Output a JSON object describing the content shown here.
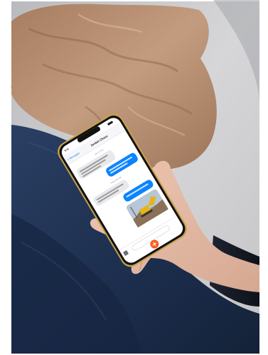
{
  "photo": {
    "description_colors": {
      "sofa": "#cfcfd1",
      "blanket": "#b68c6e",
      "jeans": "#1f3253",
      "skin": "#e2b9a3",
      "phone_frame": "#c9a14a"
    }
  },
  "phone_screen": {
    "status_time": "9:41",
    "back_label": "< Messages",
    "contact_name": "Jordan Chase",
    "timestamp_1": "Mar 14 9:41",
    "timestamp_2": "Today 9:41 AM",
    "messages": [
      {
        "side": "in",
        "text": ""
      },
      {
        "side": "out",
        "text": ""
      },
      {
        "side": "in",
        "text": ""
      },
      {
        "side": "out",
        "text": ""
      }
    ],
    "accent_color": "#0a84ff",
    "compose_button_color": "#ff5a1f"
  }
}
